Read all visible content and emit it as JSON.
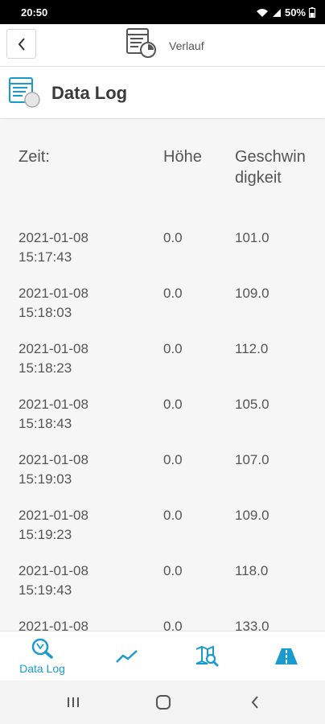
{
  "status_bar": {
    "time": "20:50",
    "battery": "50%"
  },
  "app_bar": {
    "center_label": "Verlauf"
  },
  "sub_header": {
    "title": "Data Log"
  },
  "table": {
    "headers": {
      "time": "Zeit:",
      "altitude": "Höhe",
      "speed": "Geschwindigkeit"
    },
    "rows": [
      {
        "date": "2021-01-08",
        "time": "15:17:43",
        "altitude": "0.0",
        "speed": "101.0"
      },
      {
        "date": "2021-01-08",
        "time": "15:18:03",
        "altitude": "0.0",
        "speed": "109.0"
      },
      {
        "date": "2021-01-08",
        "time": "15:18:23",
        "altitude": "0.0",
        "speed": "112.0"
      },
      {
        "date": "2021-01-08",
        "time": "15:18:43",
        "altitude": "0.0",
        "speed": "105.0"
      },
      {
        "date": "2021-01-08",
        "time": "15:19:03",
        "altitude": "0.0",
        "speed": "107.0"
      },
      {
        "date": "2021-01-08",
        "time": "15:19:23",
        "altitude": "0.0",
        "speed": "109.0"
      },
      {
        "date": "2021-01-08",
        "time": "15:19:43",
        "altitude": "0.0",
        "speed": "118.0"
      },
      {
        "date": "2021-01-08",
        "time": "",
        "altitude": "0.0",
        "speed": "133.0"
      }
    ]
  },
  "bottom_nav": {
    "items": [
      {
        "label": "Data Log",
        "icon": "data-log-search-icon",
        "active": true
      },
      {
        "label": "",
        "icon": "chart-line-icon",
        "active": false
      },
      {
        "label": "",
        "icon": "map-search-icon",
        "active": false
      },
      {
        "label": "",
        "icon": "road-icon",
        "active": false
      }
    ]
  },
  "colors": {
    "accent": "#1a9bd0",
    "text": "#555555",
    "background": "#f6f6f6"
  }
}
